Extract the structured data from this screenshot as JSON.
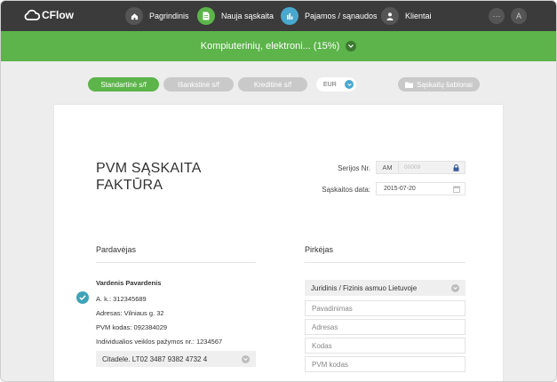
{
  "app": {
    "logo_text": "CFlow"
  },
  "nav": {
    "items": [
      {
        "label": "Pagrindinis",
        "icon": "home-icon"
      },
      {
        "label": "Nauja sąskaita",
        "icon": "new-invoice-icon"
      },
      {
        "label": "Pajamos / sąnaudos",
        "icon": "chart-icon"
      },
      {
        "label": "Klientai",
        "icon": "user-icon"
      }
    ],
    "more_label": "···",
    "avatar_initial": "A"
  },
  "company_bar": {
    "label": "Kompiuterinių, elektroni... (15%)"
  },
  "toolbar": {
    "tabs": [
      {
        "label": "Standartinė s/f",
        "active": true
      },
      {
        "label": "Išankstinė s/f",
        "active": false
      },
      {
        "label": "Kreditinė s/f",
        "active": false
      }
    ],
    "currency": "EUR",
    "templates_label": "Sąskaitų šablonai"
  },
  "document": {
    "title_line1": "PVM SĄSKAITA",
    "title_line2": "FAKTŪRA",
    "series_label": "Serijos Nr.",
    "series_prefix": "AM",
    "series_number_placeholder": "00009",
    "date_label": "Sąskaitos data:",
    "date_value": "2015-07-20"
  },
  "seller": {
    "heading": "Pardavėjas",
    "name": "Vardenis Pavardenis",
    "code": "A. k.: 312345689",
    "address": "Adresas: Vilniaus g. 32",
    "vat_code": "PVM kodas: 092384029",
    "license": "Individualios veiklos pažymos nr.: 1234567",
    "bank": "Citadele. LT02 3487 9382 4732 4"
  },
  "buyer": {
    "heading": "Pirkėjas",
    "type_select": "Juridinis / Fizinis asmuo Lietuvoje",
    "name_placeholder": "Pavadinimas",
    "address_placeholder": "Adresas",
    "code_placeholder": "Kodas",
    "vat_placeholder": "PVM kodas"
  },
  "colors": {
    "nav_bg": "#3b3b3b",
    "accent_green": "#5cb44a",
    "accent_blue": "#4aa8cf",
    "check_teal": "#3ea3b7"
  }
}
